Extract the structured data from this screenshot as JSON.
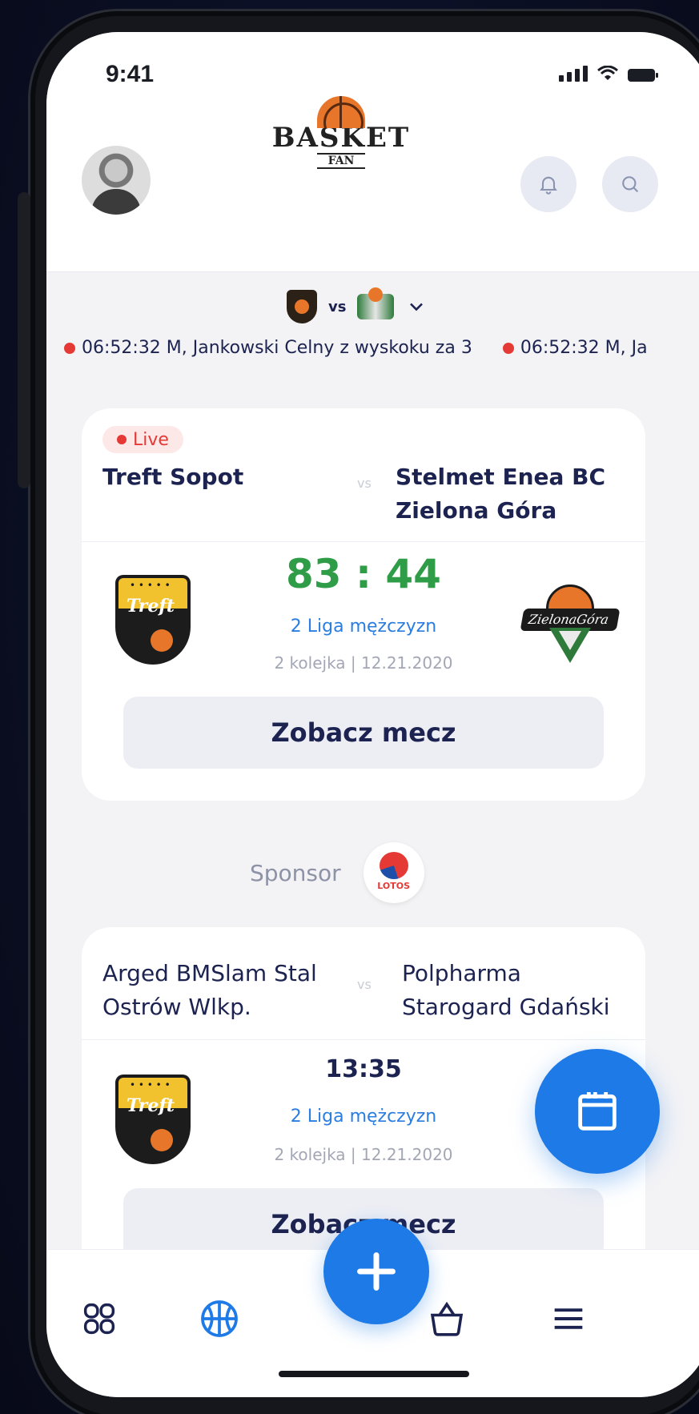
{
  "status_bar": {
    "time": "9:41"
  },
  "header": {
    "logo_word": "BASKET",
    "logo_sub": "FAN"
  },
  "ticker": {
    "vs": "vs",
    "events": [
      "06:52:32 M, Jankowski Celny z wyskoku za 3",
      "06:52:32 M, Ja"
    ]
  },
  "match1": {
    "live_label": "Live",
    "home_team": "Treft Sopot",
    "vs": "vs",
    "away_team_line1": "Stelmet Enea BC",
    "away_team_line2": "Zielona Góra",
    "score": "83 : 44",
    "league": "2 Liga mężczyzn",
    "round": "2 kolejka | 12.21.2020",
    "button": "Zobacz mecz",
    "home_logo_text": "Treft"
  },
  "sponsor": {
    "label": "Sponsor",
    "logo_text": "LOTOS"
  },
  "match2": {
    "home_team_line1": "Arged BMSlam Stal",
    "home_team_line2": "Ostrów Wlkp.",
    "vs": "vs",
    "away_team_line1": "Polpharma",
    "away_team_line2": "Starogard Gdański",
    "time": "13:35",
    "league": "2 Liga mężczyzn",
    "round": "2 kolejka | 12.21.2020",
    "button": "Zobacz mecz",
    "home_logo_text": "Treft"
  },
  "colors": {
    "accent": "#1e7ae6",
    "score_green": "#2f9d48",
    "live_red": "#e53935",
    "text_navy": "#1c2350"
  },
  "nav": {
    "items": [
      "dashboard-icon",
      "basketball-icon",
      "add-icon",
      "shop-bag-icon",
      "menu-icon"
    ],
    "active": "basketball-icon"
  }
}
